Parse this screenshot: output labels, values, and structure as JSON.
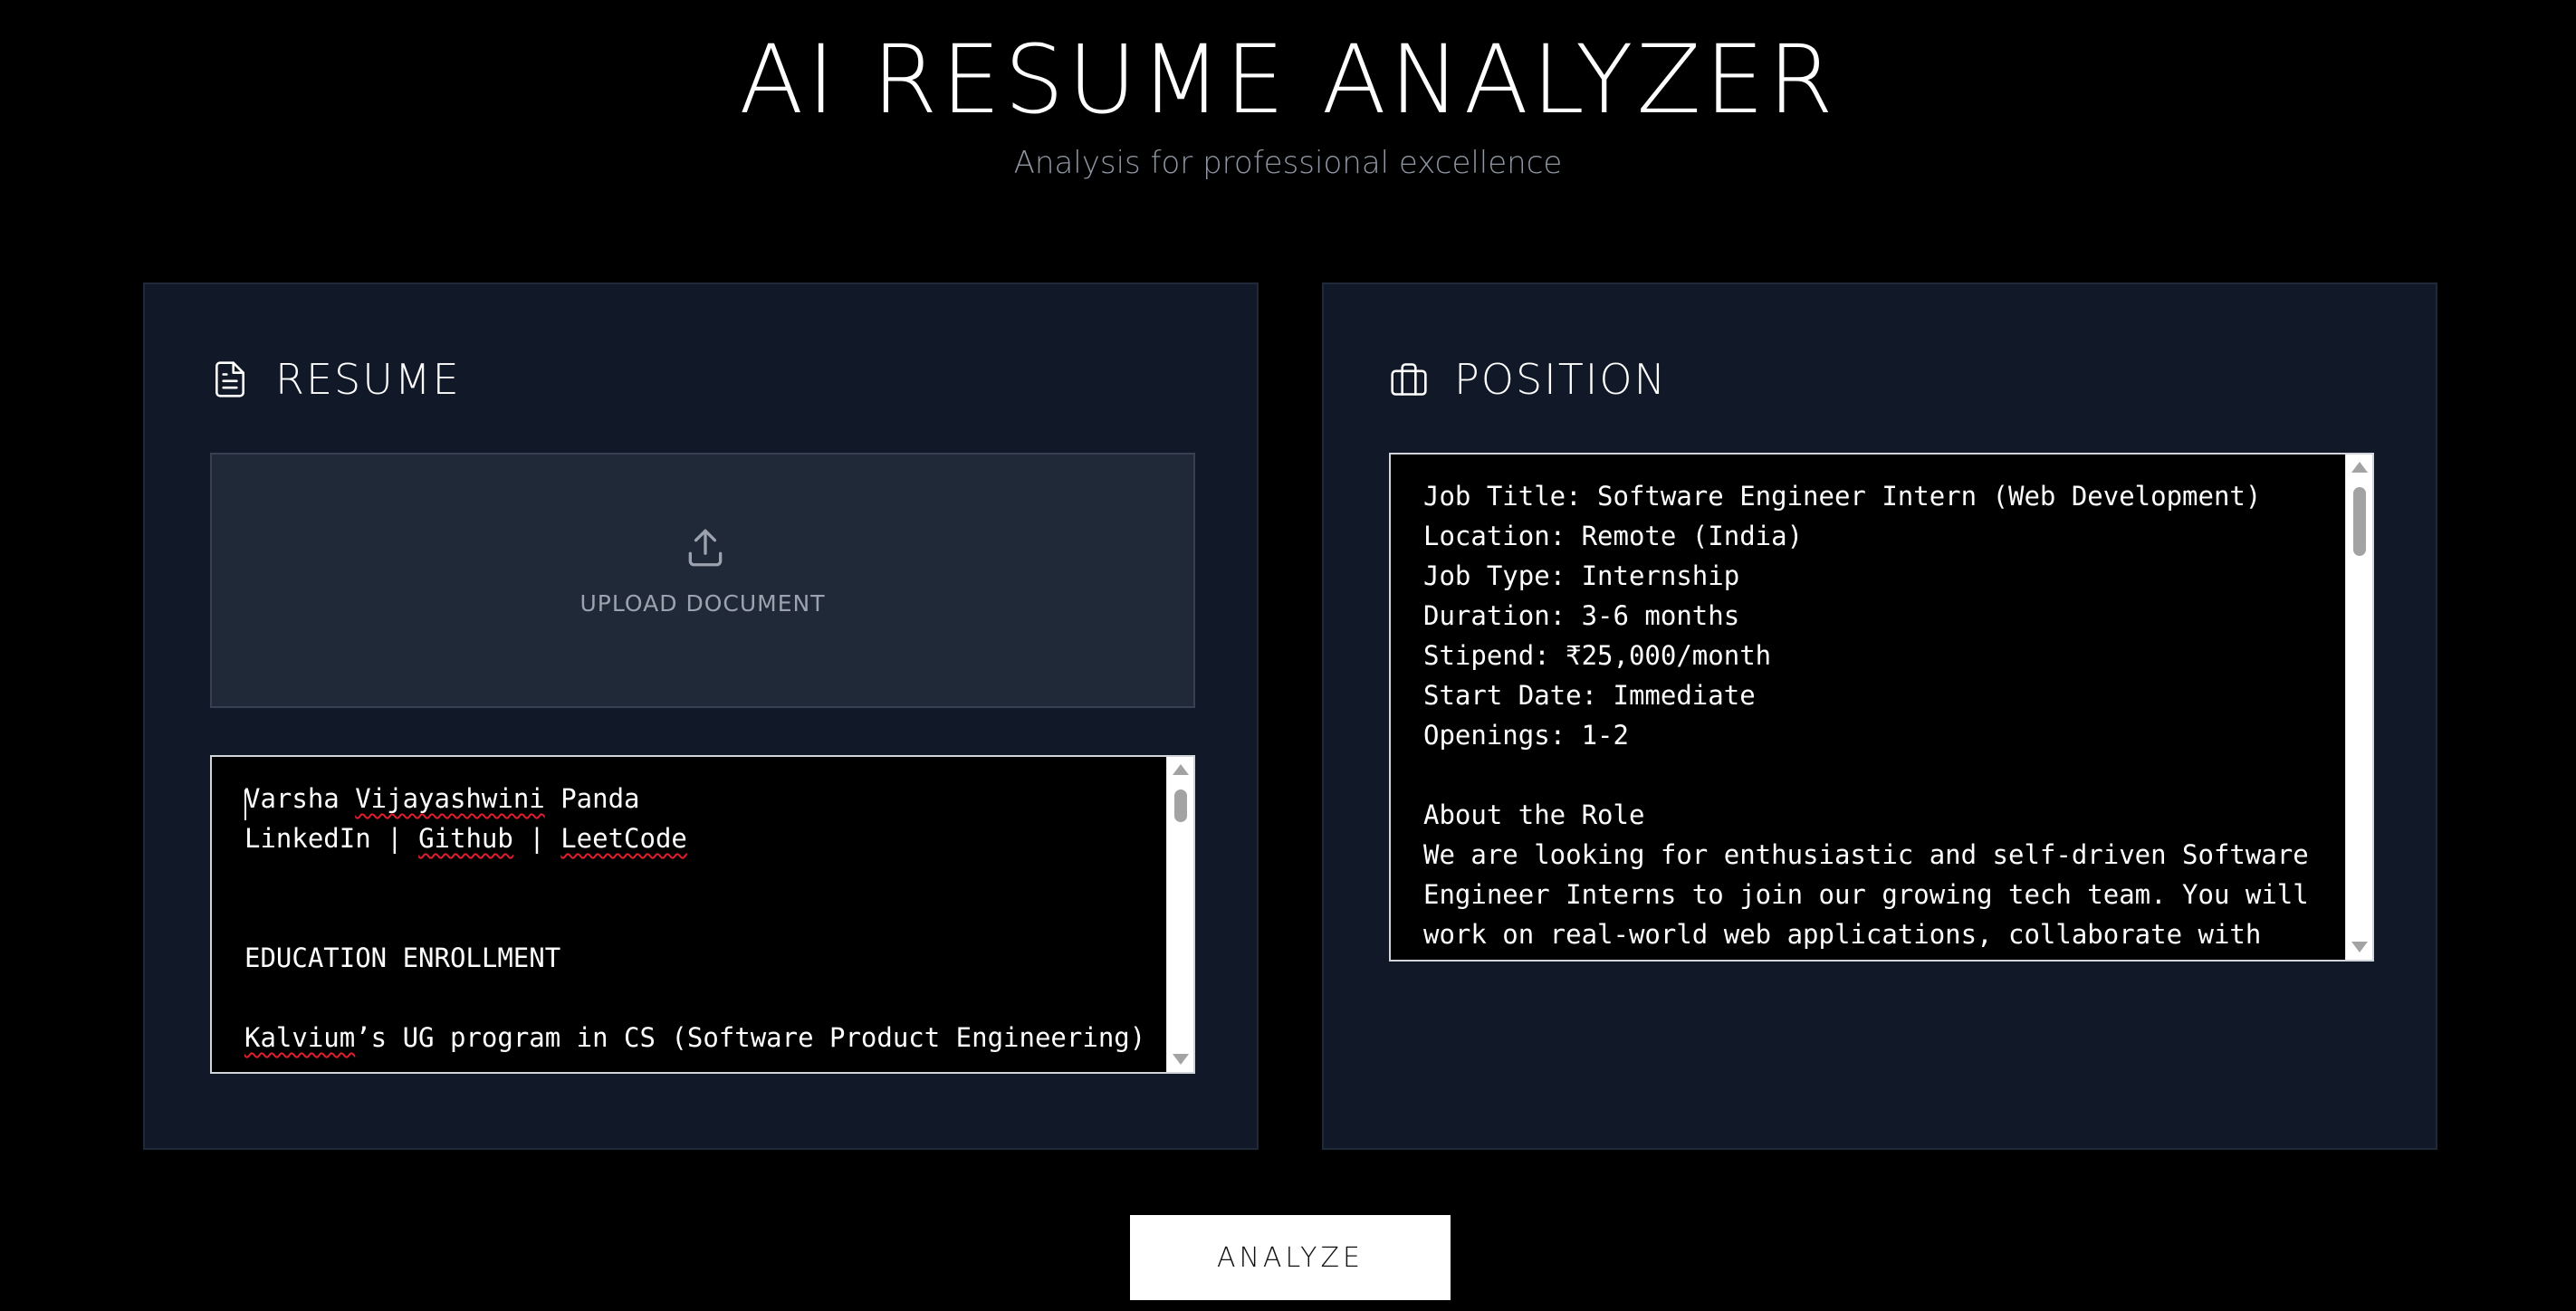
{
  "header": {
    "title": "AI RESUME ANALYZER",
    "subtitle": "Analysis for professional excellence"
  },
  "resume_panel": {
    "title": "RESUME",
    "icon": "document-icon",
    "upload": {
      "label": "UPLOAD DOCUMENT",
      "icon": "upload-icon"
    },
    "text_lines": [
      [
        "Varsha ",
        "Vijayashwini",
        " Panda"
      ],
      [
        "LinkedIn | ",
        "Github",
        " | ",
        "LeetCode"
      ],
      [
        ""
      ],
      [
        ""
      ],
      [
        "EDUCATION ENROLLMENT"
      ],
      [
        ""
      ],
      [
        "Kalvium",
        "’s UG program in CS (Software Product Engineering)"
      ]
    ]
  },
  "position_panel": {
    "title": "POSITION",
    "icon": "briefcase-icon",
    "text_lines": [
      "Job Title: Software Engineer Intern (Web Development)",
      "Location: Remote (India)",
      "Job Type: Internship",
      "Duration: 3-6 months",
      "Stipend: ₹25,000/month",
      "Start Date: Immediate",
      "Openings: 1-2",
      "",
      "About the Role",
      "We are looking for enthusiastic and self-driven Software",
      "Engineer Interns to join our growing tech team. You will",
      "work on real-world web applications, collaborate with"
    ]
  },
  "analyze_button": {
    "label": "ANALYZE"
  },
  "colors": {
    "background": "#000000",
    "panel": "#111827",
    "upload_zone": "#1f2937",
    "subtitle": "#8f96a3",
    "spellcheck": "#e11d2e"
  }
}
